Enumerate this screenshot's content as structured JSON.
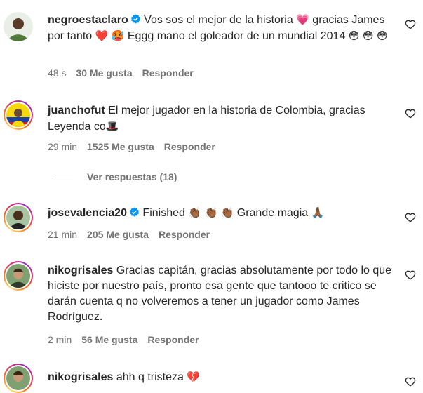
{
  "comments": [
    {
      "username": "negroestaclaro",
      "verified": true,
      "text_parts": [
        "Vos sos el mejor de la historia ",
        "💗",
        " gracias James por tanto ",
        "❤️",
        " ",
        "🥵",
        " Eggg mano el goleador de un mundial 2014 ",
        "😳",
        " ",
        "😳",
        " ",
        "😳"
      ],
      "time": "48 s",
      "likes": "30 Me gusta",
      "reply": "Responder"
    },
    {
      "username": "juanchofut",
      "verified": false,
      "text_parts": [
        "El mejor jugador en la historia de Colombia, gracias Leyenda co",
        "🎩"
      ],
      "time": "29 min",
      "likes": "1525 Me gusta",
      "reply": "Responder",
      "view_replies": "Ver respuestas (18)"
    },
    {
      "username": "josevalencia20",
      "verified": true,
      "text_parts": [
        "Finished ",
        "👏🏾",
        " ",
        "👏🏾",
        " ",
        "👏🏾",
        " Grande magia ",
        "🙏🏾"
      ],
      "time": "21 min",
      "likes": "205 Me gusta",
      "reply": "Responder"
    },
    {
      "username": "nikogrisales",
      "verified": false,
      "text_parts": [
        "Gracias capitán, gracias absolutamente por todo lo que hiciste por nuestro país, pronto esa gente que tantooo te critico se darán cuenta q no volveremos a tener un jugador como James Rodríguez."
      ],
      "time": "2 min",
      "likes": "56 Me gusta",
      "reply": "Responder"
    },
    {
      "username": "nikogrisales",
      "verified": false,
      "text_parts": [
        "ahh q tristeza ",
        "💔"
      ]
    }
  ],
  "colors": {
    "text": "#262626",
    "secondary": "#737373",
    "verified": "#0095f6"
  },
  "icons": [
    "heart-outline-icon",
    "verified-badge-icon"
  ]
}
